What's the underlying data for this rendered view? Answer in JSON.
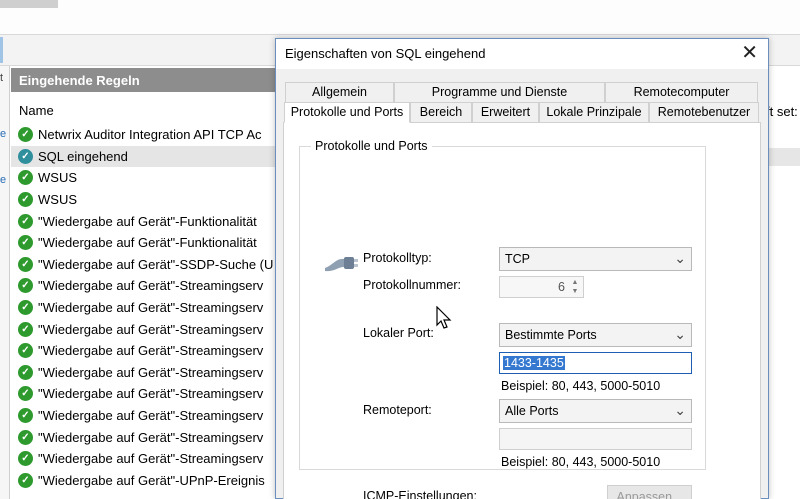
{
  "background": {
    "pane_title": "Eingehende Regeln",
    "column_name": "Name",
    "right_fragment": "ft set:",
    "rules": [
      {
        "label": "Netwrix Auditor Integration API TCP Ac",
        "selected": false
      },
      {
        "label": "SQL eingehend",
        "selected": true
      },
      {
        "label": "WSUS",
        "selected": false
      },
      {
        "label": "WSUS",
        "selected": false
      },
      {
        "label": "\"Wiedergabe auf Gerät\"-Funktionalität",
        "selected": false
      },
      {
        "label": "\"Wiedergabe auf Gerät\"-Funktionalität",
        "selected": false
      },
      {
        "label": "\"Wiedergabe auf Gerät\"-SSDP-Suche (U",
        "selected": false
      },
      {
        "label": "\"Wiedergabe auf Gerät\"-Streamingserv",
        "selected": false
      },
      {
        "label": "\"Wiedergabe auf Gerät\"-Streamingserv",
        "selected": false
      },
      {
        "label": "\"Wiedergabe auf Gerät\"-Streamingserv",
        "selected": false
      },
      {
        "label": "\"Wiedergabe auf Gerät\"-Streamingserv",
        "selected": false
      },
      {
        "label": "\"Wiedergabe auf Gerät\"-Streamingserv",
        "selected": false
      },
      {
        "label": "\"Wiedergabe auf Gerät\"-Streamingserv",
        "selected": false
      },
      {
        "label": "\"Wiedergabe auf Gerät\"-Streamingserv",
        "selected": false
      },
      {
        "label": "\"Wiedergabe auf Gerät\"-Streamingserv",
        "selected": false
      },
      {
        "label": "\"Wiedergabe auf Gerät\"-Streamingserv",
        "selected": false
      },
      {
        "label": "\"Wiedergabe auf Gerät\"-UPnP-Ereignis",
        "selected": false
      }
    ]
  },
  "dialog": {
    "title": "Eigenschaften von SQL eingehend",
    "close_symbol": "✕",
    "tabs_row1": [
      "Allgemein",
      "Programme und Dienste",
      "Remotecomputer"
    ],
    "tabs_row2": [
      "Protokolle und Ports",
      "Bereich",
      "Erweitert",
      "Lokale Prinzipale",
      "Remotebenutzer"
    ],
    "active_tab": "Protokolle und Ports",
    "group_title": "Protokolle und Ports",
    "protocol_type_label": "Protokolltyp:",
    "protocol_type_value": "TCP",
    "protocol_number_label": "Protokollnummer:",
    "protocol_number_value": "6",
    "local_port_label": "Lokaler Port:",
    "local_port_mode": "Bestimmte Ports",
    "local_port_value": "1433-1435",
    "local_port_example": "Beispiel: 80, 443, 5000-5010",
    "remote_port_label": "Remoteport:",
    "remote_port_mode": "Alle Ports",
    "remote_port_value": "",
    "remote_port_example": "Beispiel: 80, 443, 5000-5010",
    "icmp_label": "ICMP-Einstellungen:",
    "customize_button": "Anpassen..."
  },
  "colors": {
    "pane_header_bg": "#8d8d8d",
    "check_green": "#2e9a2e",
    "selection_blue": "#3478d0"
  }
}
